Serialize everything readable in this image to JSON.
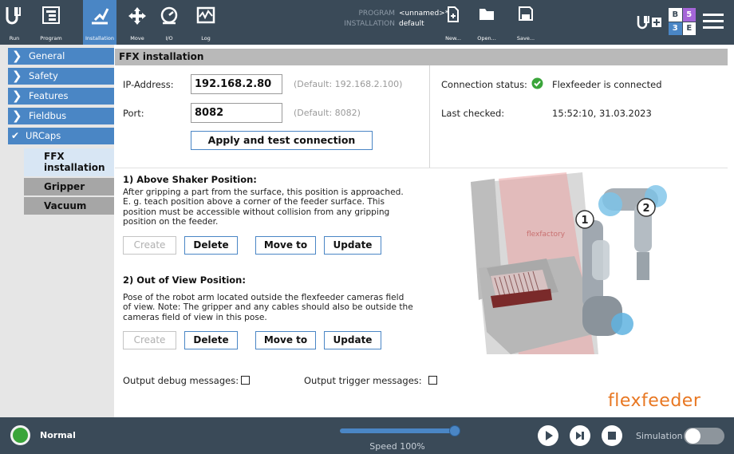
{
  "topbar": {
    "run_label": "Run",
    "program_label": "Program",
    "installation_label": "Installation",
    "move_label": "Move",
    "io_label": "I/O",
    "log_label": "Log",
    "program_key": "PROGRAM",
    "program_value": "<unnamed>*",
    "installation_key": "INSTALLATION",
    "installation_value": "default",
    "new_label": "New...",
    "open_label": "Open...",
    "save_label": "Save...",
    "urplus_icon": "UR+",
    "badge": [
      "B",
      "5",
      "3",
      "E"
    ],
    "badge_colors": [
      "#ffffff",
      "#a566d8",
      "#4a86c5",
      "#ffffff"
    ],
    "menu_icon": "hamburger-menu-icon"
  },
  "sidebar": {
    "items": [
      {
        "label": "General"
      },
      {
        "label": "Safety"
      },
      {
        "label": "Features"
      },
      {
        "label": "Fieldbus"
      },
      {
        "label": "URCaps"
      }
    ],
    "sub_items": [
      {
        "label": "FFX installation"
      },
      {
        "label": "Gripper"
      },
      {
        "label": "Vacuum"
      }
    ]
  },
  "main": {
    "title": "FFX installation",
    "ip_label": "IP-Address:",
    "ip_value": "192.168.2.80",
    "ip_default": "(Default: 192.168.2.100)",
    "port_label": "Port:",
    "port_value": "8082",
    "port_default": "(Default: 8082)",
    "apply_button": "Apply and test connection",
    "connection_label": "Connection status:",
    "connection_value": "Flexfeeder is connected",
    "last_checked_label": "Last checked:",
    "last_checked_value": "15:52:10, 31.03.2023",
    "section1_title": "1) Above Shaker Position:",
    "section1_text": [
      "After gripping a part from the surface, this position is approached.",
      "E. g. teach position above a corner of the feeder surface. This",
      "position must be accessible without collision from any gripping",
      "position on the feeder."
    ],
    "section2_title": "2) Out of View Position:",
    "section2_text": [
      "Pose of the robot arm located outside the flexfeeder cameras field",
      "of view. Note: The gripper and any cables should also be outside the",
      "cameras field of view in this pose."
    ],
    "create_button": "Create",
    "delete_button": "Delete",
    "moveto_button": "Move to",
    "update_button": "Update",
    "debug_label": "Output debug messages:",
    "trigger_label": "Output trigger messages:",
    "brand": "flexfeeder",
    "image_marker1": "1",
    "image_marker2": "2",
    "image_feeder_text": "flexfactory"
  },
  "footer": {
    "status": "Normal",
    "speed": "Speed 100%",
    "speed_fraction": 1.0,
    "simulation_label": "Simulation"
  },
  "colors": {
    "topbar": "#3a4a58",
    "accent": "#4a86c5",
    "status_green": "#3aa53a",
    "brand_orange": "#e87722"
  }
}
